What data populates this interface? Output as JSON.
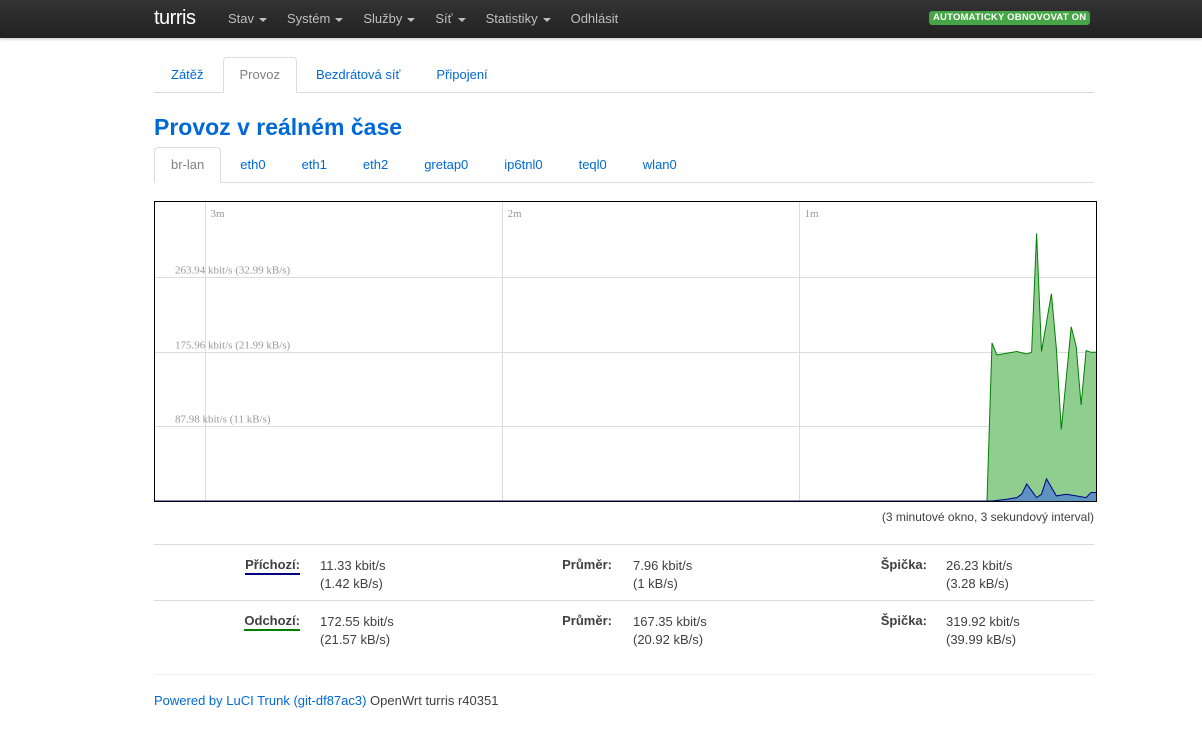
{
  "brand": "turris",
  "nav": [
    {
      "label": "Stav",
      "dropdown": true
    },
    {
      "label": "Systém",
      "dropdown": true
    },
    {
      "label": "Služby",
      "dropdown": true
    },
    {
      "label": "Síť",
      "dropdown": true
    },
    {
      "label": "Statistiky",
      "dropdown": true
    },
    {
      "label": "Odhlásit",
      "dropdown": false
    }
  ],
  "autoupdate_badge": "AUTOMATICKY OBNOVOVAT ON",
  "main_tabs": [
    "Zátěž",
    "Provoz",
    "Bezdrátová síť",
    "Připojení"
  ],
  "main_tab_active": "Provoz",
  "page_title": "Provoz v reálném čase",
  "iface_tabs": [
    "br-lan",
    "eth0",
    "eth1",
    "eth2",
    "gretap0",
    "ip6tnl0",
    "teql0",
    "wlan0"
  ],
  "iface_tab_active": "br-lan",
  "chart_data": {
    "type": "area",
    "x_ticks": [
      "3m",
      "2m",
      "1m"
    ],
    "y_labels": [
      "263.94 kbit/s (32.99 kB/s)",
      "175.96 kbit/s (21.99 kB/s)",
      "87.98 kbit/s (11 kB/s)"
    ],
    "y_values": [
      263.94,
      175.96,
      87.98
    ],
    "ylim": [
      0,
      351.92
    ],
    "x_unit": "seconds ago",
    "xlim": [
      -190,
      0
    ],
    "grid": true,
    "series": [
      {
        "name": "Odchozí",
        "color": "#008000",
        "fill": "#8fce8f",
        "x": [
          -190,
          -22,
          -21,
          -20,
          -18,
          -16,
          -14,
          -13,
          -12,
          -11,
          -9,
          -8,
          -7,
          -5,
          -4,
          -3,
          -2,
          -1,
          0
        ],
        "values": [
          0,
          0,
          186,
          172,
          174,
          176,
          173,
          175,
          315,
          176,
          244,
          179,
          84,
          205,
          182,
          113,
          177,
          175,
          175
        ]
      },
      {
        "name": "Příchozí",
        "color": "#000080",
        "fill": "#5c8ec4",
        "x": [
          -190,
          -21,
          -18,
          -16,
          -15,
          -14,
          -12,
          -11,
          -10,
          -8,
          -6,
          -4,
          -2,
          -1,
          0
        ],
        "values": [
          0,
          0,
          2,
          4,
          8,
          20,
          4,
          8,
          26,
          6,
          8,
          6,
          4,
          10,
          10
        ]
      }
    ]
  },
  "interval_note": "(3 minutové okno, 3 sekundový interval)",
  "stats": {
    "incoming": {
      "label": "Příchozí:",
      "color": "#000080",
      "current": "11.33 kbit/s",
      "current_kb": "(1.42 kB/s)",
      "avg_label": "Průměr:",
      "avg": "7.96 kbit/s",
      "avg_kb": "(1 kB/s)",
      "peak_label": "Špička:",
      "peak": "26.23 kbit/s",
      "peak_kb": "(3.28 kB/s)"
    },
    "outgoing": {
      "label": "Odchozí:",
      "color": "#008000",
      "current": "172.55 kbit/s",
      "current_kb": "(21.57 kB/s)",
      "avg_label": "Průměr:",
      "avg": "167.35 kbit/s",
      "avg_kb": "(20.92 kB/s)",
      "peak_label": "Špička:",
      "peak": "319.92 kbit/s",
      "peak_kb": "(39.99 kB/s)"
    }
  },
  "footer": {
    "link": "Powered by LuCI Trunk (git-df87ac3)",
    "text": " OpenWrt turris r40351"
  }
}
